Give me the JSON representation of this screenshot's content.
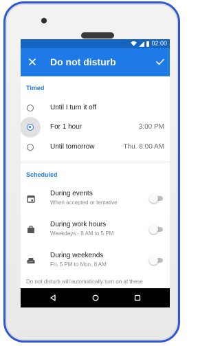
{
  "colors": {
    "status_bar": "#1565c0",
    "app_bar": "#1e7ae6",
    "accent": "#1e7ae6",
    "phone_frame": "#2f56d6",
    "nav_bar": "#000000"
  },
  "status_bar": {
    "time": "02:00",
    "icons": [
      "wifi-icon",
      "signal-icon",
      "battery-icon"
    ]
  },
  "app_bar": {
    "close_icon": "close-icon",
    "title": "Do not disturb",
    "confirm_icon": "check-icon"
  },
  "timed": {
    "header": "Timed",
    "options": [
      {
        "label": "Until I turn it off",
        "value": "",
        "selected": false
      },
      {
        "label": "For 1 hour",
        "value": "3:00 PM",
        "selected": true
      },
      {
        "label": "Until tomorrow",
        "value": "Thu. 8:00 AM",
        "selected": false
      }
    ]
  },
  "scheduled": {
    "header": "Scheduled",
    "rules": [
      {
        "icon": "calendar-icon",
        "title": "During events",
        "subtitle": "When accepted or tentative",
        "enabled": false
      },
      {
        "icon": "briefcase-icon",
        "title": "During work hours",
        "subtitle": "Weekdays - 8 AM to 5 PM",
        "enabled": false
      },
      {
        "icon": "sofa-icon",
        "title": "During weekends",
        "subtitle": "Fri. 5 PM to Mon. 8 AM",
        "enabled": false
      }
    ]
  },
  "footer_note": "Do not disturb will automatically turn on at these",
  "nav_bar": {
    "buttons": [
      "back-icon",
      "home-icon",
      "recents-icon"
    ]
  }
}
